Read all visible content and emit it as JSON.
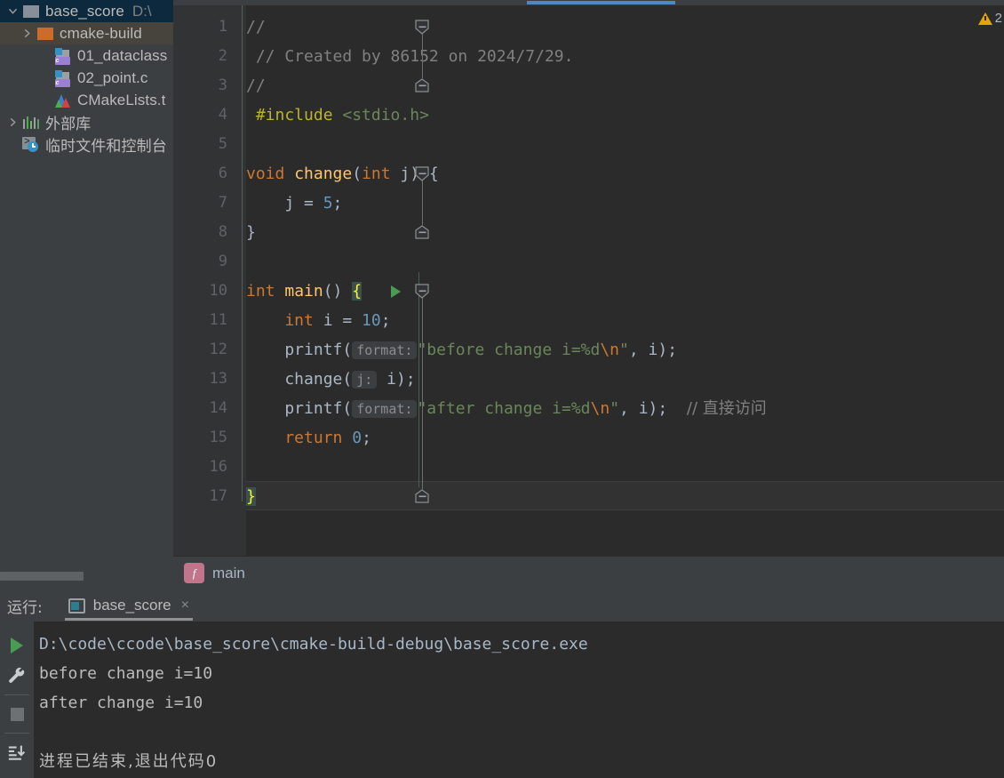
{
  "project_tree": {
    "items": [
      {
        "label": "base_score",
        "path_suffix": "D:\\",
        "icon": "folder-icon",
        "arrow": "chevron-down-icon",
        "state": "selected",
        "depth": 0
      },
      {
        "label": "cmake-build",
        "path_suffix": "",
        "icon": "folder-orange-icon",
        "arrow": "chevron-right-icon",
        "state": "hovered",
        "depth": 1
      },
      {
        "label": "01_dataclass",
        "path_suffix": "",
        "icon": "c-file-icon",
        "arrow": "",
        "state": "normal",
        "depth": 2
      },
      {
        "label": "02_point.c",
        "path_suffix": "",
        "icon": "c-file-icon",
        "arrow": "",
        "state": "normal",
        "depth": 2
      },
      {
        "label": "CMakeLists.t",
        "path_suffix": "",
        "icon": "cmake-icon",
        "arrow": "",
        "state": "normal",
        "depth": 2
      },
      {
        "label": "外部库",
        "path_suffix": "",
        "icon": "library-icon",
        "arrow": "chevron-right-icon",
        "state": "normal",
        "depth": 0
      },
      {
        "label": "临时文件和控制台",
        "path_suffix": "",
        "icon": "scratch-icon",
        "arrow": "",
        "state": "normal",
        "depth": 0
      }
    ]
  },
  "editor": {
    "warning_badge": {
      "icon": "warning-triangle-icon",
      "count": "2"
    },
    "gutter_line_numbers": [
      "1",
      "2",
      "3",
      "4",
      "5",
      "6",
      "7",
      "8",
      "9",
      "10",
      "11",
      "12",
      "13",
      "14",
      "15",
      "16",
      "17"
    ],
    "run_marker_line": "10",
    "current_line": "17",
    "lines": [
      {
        "n": "1",
        "tokens": [
          {
            "t": "//",
            "c": "c-comment"
          }
        ]
      },
      {
        "n": "2",
        "tokens": [
          {
            "t": " // Created by 86152 on 2024/7/29.",
            "c": "c-comment"
          }
        ]
      },
      {
        "n": "3",
        "tokens": [
          {
            "t": "//",
            "c": "c-comment"
          }
        ]
      },
      {
        "n": "4",
        "tokens": [
          {
            "t": " #include ",
            "c": "c-macro"
          },
          {
            "t": "<stdio.h>",
            "c": "c-include"
          }
        ]
      },
      {
        "n": "5",
        "tokens": []
      },
      {
        "n": "6",
        "tokens": [
          {
            "t": "void ",
            "c": "c-keyword"
          },
          {
            "t": "change",
            "c": "c-func"
          },
          {
            "t": "(",
            "c": "c-plain"
          },
          {
            "t": "int",
            "c": "c-keyword"
          },
          {
            "t": " j) {",
            "c": "c-plain"
          }
        ]
      },
      {
        "n": "7",
        "tokens": [
          {
            "t": "    j = ",
            "c": "c-plain"
          },
          {
            "t": "5",
            "c": "c-number"
          },
          {
            "t": ";",
            "c": "c-plain"
          }
        ]
      },
      {
        "n": "8",
        "tokens": [
          {
            "t": "}",
            "c": "c-plain"
          }
        ]
      },
      {
        "n": "9",
        "tokens": []
      },
      {
        "n": "10",
        "tokens": [
          {
            "t": "int ",
            "c": "c-keyword"
          },
          {
            "t": "main",
            "c": "c-func"
          },
          {
            "t": "() ",
            "c": "c-plain"
          },
          {
            "t": "{",
            "c": "c-brace-hl"
          }
        ]
      },
      {
        "n": "11",
        "tokens": [
          {
            "t": "    int",
            "c": "c-keyword"
          },
          {
            "t": " i = ",
            "c": "c-plain"
          },
          {
            "t": "10",
            "c": "c-number"
          },
          {
            "t": ";",
            "c": "c-plain"
          }
        ]
      },
      {
        "n": "12",
        "tokens": [
          {
            "t": "    printf(",
            "c": "c-plain"
          },
          {
            "t": "format:",
            "c": "hint"
          },
          {
            "t": "\"before change i=%d",
            "c": "c-string"
          },
          {
            "t": "\\n",
            "c": "c-escape"
          },
          {
            "t": "\"",
            "c": "c-string"
          },
          {
            "t": ", i);",
            "c": "c-plain"
          }
        ]
      },
      {
        "n": "13",
        "tokens": [
          {
            "t": "    change(",
            "c": "c-plain"
          },
          {
            "t": "j:",
            "c": "hint"
          },
          {
            "t": " i);",
            "c": "c-plain"
          }
        ]
      },
      {
        "n": "14",
        "tokens": [
          {
            "t": "    printf(",
            "c": "c-plain"
          },
          {
            "t": "format:",
            "c": "hint"
          },
          {
            "t": "\"after change i=%d",
            "c": "c-string"
          },
          {
            "t": "\\n",
            "c": "c-escape"
          },
          {
            "t": "\"",
            "c": "c-string"
          },
          {
            "t": ", i);  ",
            "c": "c-plain"
          },
          {
            "t": "// 直接访问",
            "c": "c-comment"
          }
        ]
      },
      {
        "n": "15",
        "tokens": [
          {
            "t": "    return ",
            "c": "c-keyword"
          },
          {
            "t": "0",
            "c": "c-number"
          },
          {
            "t": ";",
            "c": "c-plain"
          }
        ]
      },
      {
        "n": "16",
        "tokens": []
      },
      {
        "n": "17",
        "tokens": [
          {
            "t": "}",
            "c": "c-brace-hl"
          }
        ]
      }
    ]
  },
  "breadcrumb": {
    "badge": "f",
    "label": "main"
  },
  "run_panel": {
    "title": "运行:",
    "tab": {
      "label": "base_score",
      "close": "×",
      "icon": "console-window-icon"
    },
    "toolbar": [
      {
        "name": "rerun-button",
        "icon": "play-icon"
      },
      {
        "name": "edit-configurations-button",
        "icon": "wrench-icon"
      },
      {
        "name": "stop-button",
        "icon": "stop-icon"
      },
      {
        "name": "scroll-to-end-button",
        "icon": "scroll-to-end-icon"
      }
    ],
    "console_lines": [
      {
        "text": "D:\\code\\ccode\\base_score\\cmake-build-debug\\base_score.exe",
        "cn": false
      },
      {
        "text": "before change i=10",
        "cn": false
      },
      {
        "text": "after change i=10",
        "cn": false
      },
      {
        "text": "",
        "cn": false
      },
      {
        "text": "进程已结束,退出代码0",
        "cn": true
      }
    ]
  },
  "colors": {
    "editor_bg": "#2b2b2b",
    "panel_bg": "#3c3f41",
    "gutter_bg": "#313335",
    "selection_blue": "#0d293e",
    "hover_brown": "#46443c",
    "tab_accent": "#4a88c7",
    "keyword_orange": "#cc7832",
    "string_green": "#6a8759",
    "number_blue": "#6897bb",
    "function_yellow": "#ffc66d",
    "comment_grey": "#808080",
    "macro_olive": "#bbb529",
    "warning_yellow": "#e5a50a",
    "run_green": "#499c54",
    "breadcrumb_badge": "#c2748b"
  }
}
